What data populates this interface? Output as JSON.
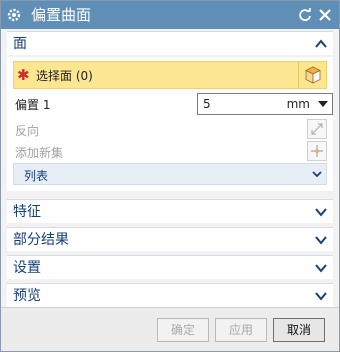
{
  "title": "偏置曲面",
  "sections": {
    "face": "面",
    "features": "特征",
    "partial": "部分结果",
    "settings": "设置",
    "preview": "预览"
  },
  "face": {
    "select_label": "选择面 (0)",
    "offset_label": "偏置 1",
    "offset_value": "5",
    "offset_unit": "mm",
    "reverse_label": "反向",
    "add_set_label": "添加新集",
    "list_label": "列表"
  },
  "buttons": {
    "ok": "确定",
    "apply": "应用",
    "cancel": "取消"
  },
  "colors": {
    "titlebar": "#5f8fb7",
    "selection_highlight": "#fde691",
    "section_text": "#173f7a",
    "required_star": "#d32a2a"
  },
  "icons": [
    "gear-icon",
    "reset-icon",
    "close-icon",
    "chevron-up-icon",
    "chevron-down-icon",
    "cube-icon",
    "reverse-direction-icon",
    "add-set-icon"
  ]
}
